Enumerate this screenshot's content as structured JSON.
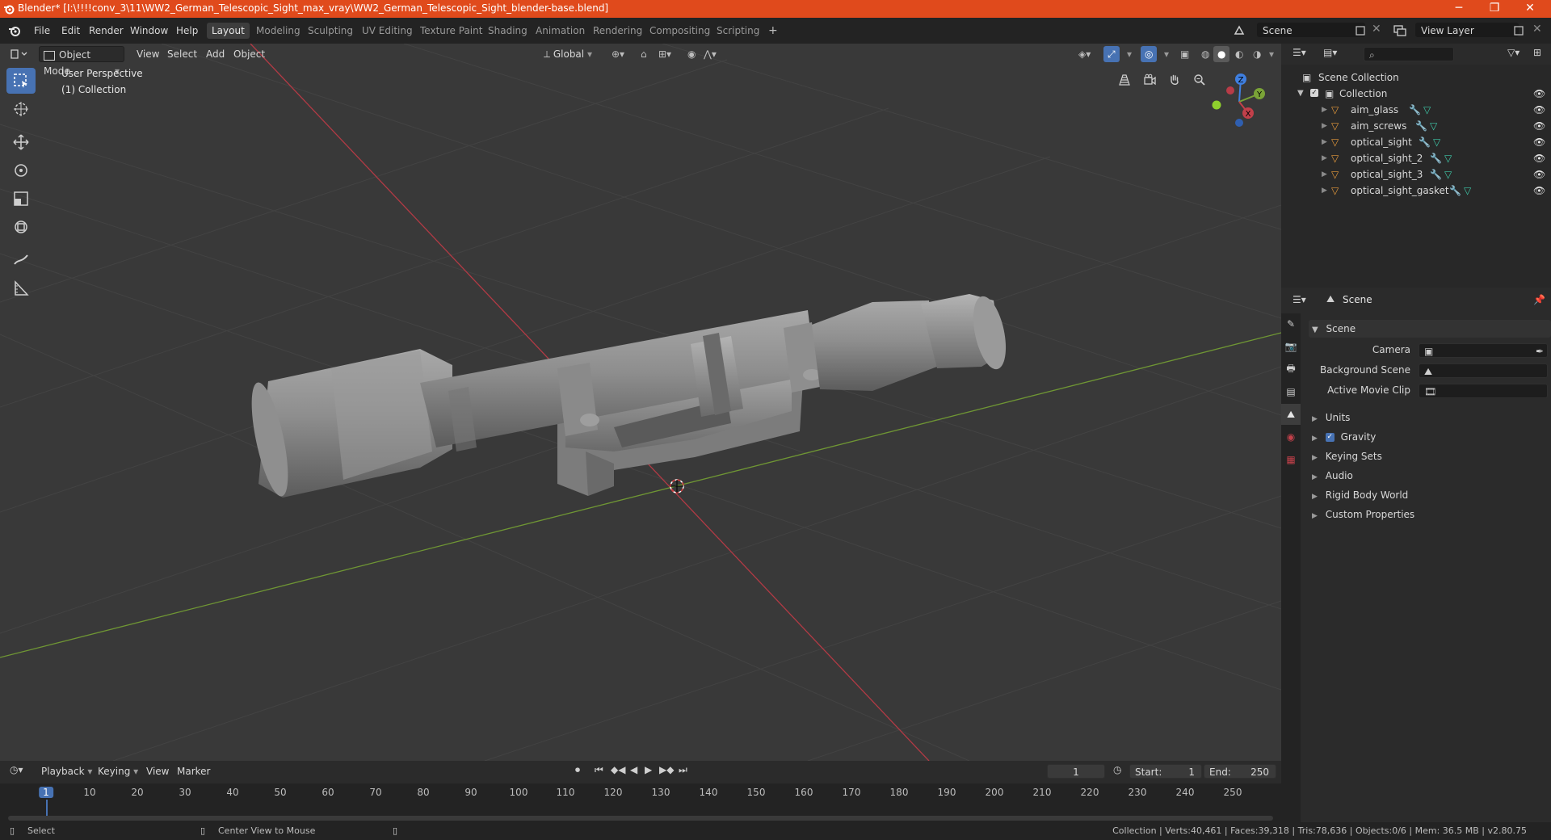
{
  "window": {
    "title": "Blender* [I:\\!!!!conv_3\\11\\WW2_German_Telescopic_Sight_max_vray\\WW2_German_Telescopic_Sight_blender-base.blend]",
    "minimize": "─",
    "maximize": "❐",
    "close": "✕"
  },
  "menubar": {
    "menus": [
      "File",
      "Edit",
      "Render",
      "Window",
      "Help"
    ],
    "workspaces": [
      "Layout",
      "Modeling",
      "Sculpting",
      "UV Editing",
      "Texture Paint",
      "Shading",
      "Animation",
      "Rendering",
      "Compositing",
      "Scripting"
    ],
    "active_workspace": "Layout",
    "add_workspace": "+",
    "scene_label": "Scene",
    "view_layer_label": "View Layer"
  },
  "viewport": {
    "mode": "Object Mode",
    "menus": [
      "View",
      "Select",
      "Add",
      "Object"
    ],
    "transform_orientation": "Global",
    "perspective_label": "User Perspective",
    "collection_label": "(1) Collection",
    "gizmo": {
      "x": "X",
      "y": "Y",
      "z": "Z"
    }
  },
  "outliner": {
    "search_placeholder": "",
    "root": "Scene Collection",
    "collection": "Collection",
    "objects": [
      "aim_glass",
      "aim_screws",
      "optical_sight",
      "optical_sight_2",
      "optical_sight_3",
      "optical_sight_gasket"
    ]
  },
  "properties": {
    "context_title": "Scene",
    "panel_title": "Scene",
    "fields": [
      {
        "label": "Camera",
        "value": ""
      },
      {
        "label": "Background Scene",
        "value": ""
      },
      {
        "label": "Active Movie Clip",
        "value": ""
      }
    ],
    "sections": [
      "Units",
      "Gravity",
      "Keying Sets",
      "Audio",
      "Rigid Body World",
      "Custom Properties"
    ],
    "gravity_checked": true
  },
  "timeline": {
    "menus": [
      "Playback",
      "Keying",
      "View",
      "Marker"
    ],
    "current_frame": "1",
    "start_label": "Start:",
    "start_value": "1",
    "end_label": "End:",
    "end_value": "250",
    "ticks": [
      "1",
      "10",
      "20",
      "30",
      "40",
      "50",
      "60",
      "70",
      "80",
      "90",
      "100",
      "110",
      "120",
      "130",
      "140",
      "150",
      "160",
      "170",
      "180",
      "190",
      "200",
      "210",
      "220",
      "230",
      "240",
      "250"
    ]
  },
  "statusbar": {
    "left_action": "Select",
    "middle_action": "Center View to Mouse",
    "stats": "Collection | Verts:40,461 | Faces:39,318 | Tris:78,636 | Objects:0/6 | Mem: 36.5 MB | v2.80.75"
  },
  "colors": {
    "accent": "#4772b3",
    "titlebar": "#e04a1c",
    "x_axis": "#c2404a",
    "y_axis": "#7aa337",
    "z_axis": "#3f7fe0",
    "object_orange": "#e69a3c"
  }
}
